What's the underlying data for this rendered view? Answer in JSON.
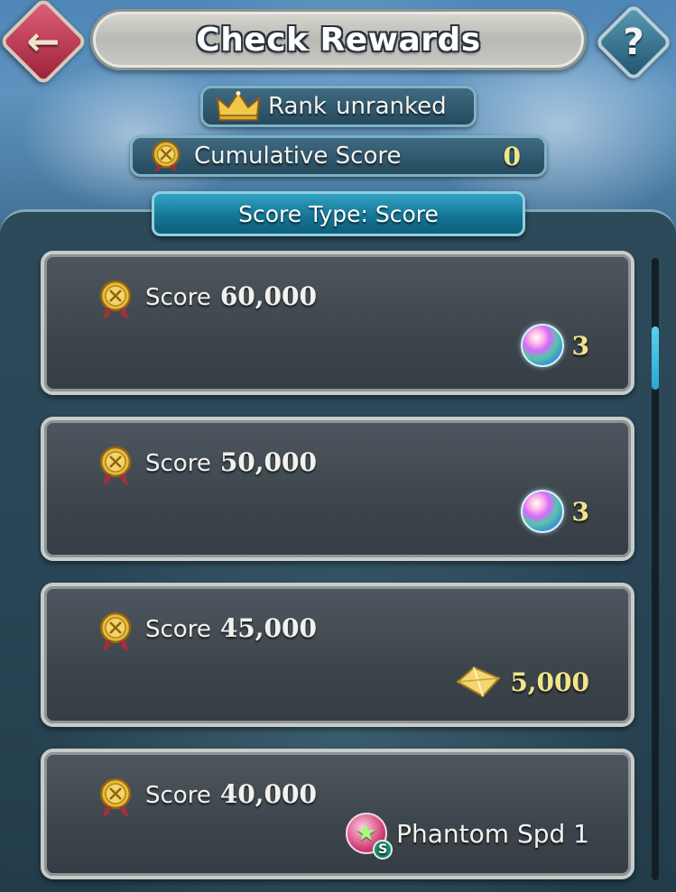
{
  "header": {
    "title": "Check Rewards",
    "back_icon": "back-arrow-icon",
    "help_label": "?"
  },
  "rank": {
    "label": "Rank",
    "value": "unranked"
  },
  "cumulative": {
    "label": "Cumulative Score",
    "value": "0"
  },
  "score_type": {
    "label": "Score Type: Score"
  },
  "rewards": [
    {
      "score_label": "Score",
      "score_value": "60,000",
      "reward_icon": "orb-icon",
      "reward_value": "3"
    },
    {
      "score_label": "Score",
      "score_value": "50,000",
      "reward_icon": "orb-icon",
      "reward_value": "3"
    },
    {
      "score_label": "Score",
      "score_value": "45,000",
      "reward_icon": "feather-icon",
      "reward_value": "5,000"
    },
    {
      "score_label": "Score",
      "score_value": "40,000",
      "reward_icon": "sacred-seal-icon",
      "reward_value": "Phantom Spd 1"
    }
  ],
  "scroll": {
    "position_fraction": 0.1
  },
  "colors": {
    "accent_gold": "#f1e58a",
    "tab_blue": "#137493",
    "back_red": "#c23a58",
    "help_teal": "#2f7795"
  }
}
